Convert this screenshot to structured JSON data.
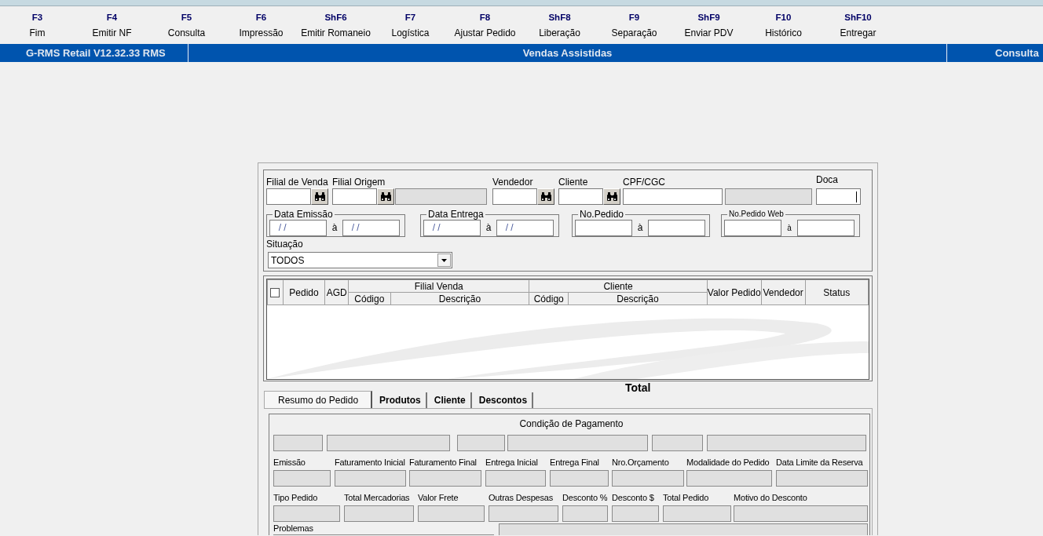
{
  "function_keys": [
    {
      "key": "F3",
      "label": "Fim"
    },
    {
      "key": "F4",
      "label": "Emitir NF"
    },
    {
      "key": "F5",
      "label": "Consulta"
    },
    {
      "key": "F6",
      "label": "Impressão"
    },
    {
      "key": "ShF6",
      "label": "Emitir Romaneio"
    },
    {
      "key": "F7",
      "label": "Logística"
    },
    {
      "key": "F8",
      "label": "Ajustar Pedido"
    },
    {
      "key": "ShF8",
      "label": "Liberação"
    },
    {
      "key": "F9",
      "label": "Separação"
    },
    {
      "key": "ShF9",
      "label": "Enviar PDV"
    },
    {
      "key": "F10",
      "label": "Histórico"
    },
    {
      "key": "ShF10",
      "label": "Entregar"
    }
  ],
  "header": {
    "app": "G-RMS Retail V12.32.33 RMS",
    "module": "Vendas Assistidas",
    "screen": "Consulta"
  },
  "filters": {
    "fields": [
      {
        "kind": "lookup",
        "label": "Filial de Venda",
        "disabled": false
      },
      {
        "kind": "lookup",
        "label": "Filial Origem",
        "disabled": false
      },
      {
        "kind": "text",
        "disabled": true
      },
      {
        "kind": "lookup",
        "label": "Vendedor",
        "disabled": false
      },
      {
        "kind": "lookup",
        "label": "Cliente",
        "disabled": false
      },
      {
        "kind": "text",
        "label": "CPF/CGC",
        "disabled": false
      },
      {
        "kind": "text",
        "disabled": true
      },
      {
        "kind": "text",
        "label": "Doca",
        "disabled": false,
        "focused": true
      }
    ],
    "ranges": [
      {
        "label": "Data Emissão",
        "from": "/ /",
        "separator": "à",
        "to": "/ /"
      },
      {
        "label": "Data Entrega",
        "from": "/ /",
        "separator": "à",
        "to": "/ /"
      },
      {
        "label": "No.Pedido",
        "separator": "à"
      },
      {
        "label": "No.Pedido Web",
        "separator": "à"
      }
    ],
    "status": {
      "label": "Situação",
      "value": "TODOS"
    }
  },
  "orders_table": {
    "select_all_checked": false,
    "columns": [
      {
        "label": "Pedido"
      },
      {
        "label": "AGD"
      },
      {
        "label": "Filial Venda",
        "children": [
          {
            "label": "Código"
          },
          {
            "label": "Descrição"
          }
        ]
      },
      {
        "label": "Cliente",
        "children": [
          {
            "label": "Código"
          },
          {
            "label": "Descrição"
          }
        ]
      },
      {
        "label": "Valor Pedido"
      },
      {
        "label": "Vendedor"
      },
      {
        "label": "Status"
      }
    ]
  },
  "total_label": "Total",
  "tabs": [
    {
      "label": "Resumo do Pedido",
      "selected": true
    },
    {
      "label": "Produtos",
      "selected": false
    },
    {
      "label": "Cliente",
      "selected": false
    },
    {
      "label": "Descontos",
      "selected": false
    }
  ],
  "summary": {
    "title": "Condição de Pagamento",
    "payment_fields": [
      {
        "disabled": true
      },
      {
        "disabled": true
      },
      {
        "disabled": true
      },
      {
        "disabled": true
      },
      {
        "disabled": true
      },
      {
        "disabled": true
      }
    ],
    "rows": [
      [
        {
          "label": "Emissão",
          "disabled": true
        },
        {
          "label": "Faturamento Inicial",
          "disabled": true
        },
        {
          "label": "Faturamento Final",
          "disabled": true
        },
        {
          "label": "Entrega Inicial",
          "disabled": true
        },
        {
          "label": "Entrega Final",
          "disabled": true
        },
        {
          "label": "Nro.Orçamento",
          "disabled": true
        },
        {
          "label": "Modalidade do Pedido",
          "disabled": true
        },
        {
          "label": "Data Limite da Reserva",
          "disabled": true
        }
      ],
      [
        {
          "label": "Tipo Pedido",
          "disabled": true
        },
        {
          "label": "Total Mercadorias",
          "disabled": true
        },
        {
          "label": "Valor Frete",
          "disabled": true
        },
        {
          "label": "Outras Despesas",
          "disabled": true
        },
        {
          "label": "Desconto %",
          "disabled": true
        },
        {
          "label": "Desconto $",
          "disabled": true
        },
        {
          "label": "Total Pedido",
          "disabled": true
        },
        {
          "label": "Motivo do Desconto",
          "disabled": true
        }
      ]
    ],
    "problems": {
      "label": "Problemas",
      "disabled": true
    },
    "notes": {
      "disabled": true
    }
  }
}
